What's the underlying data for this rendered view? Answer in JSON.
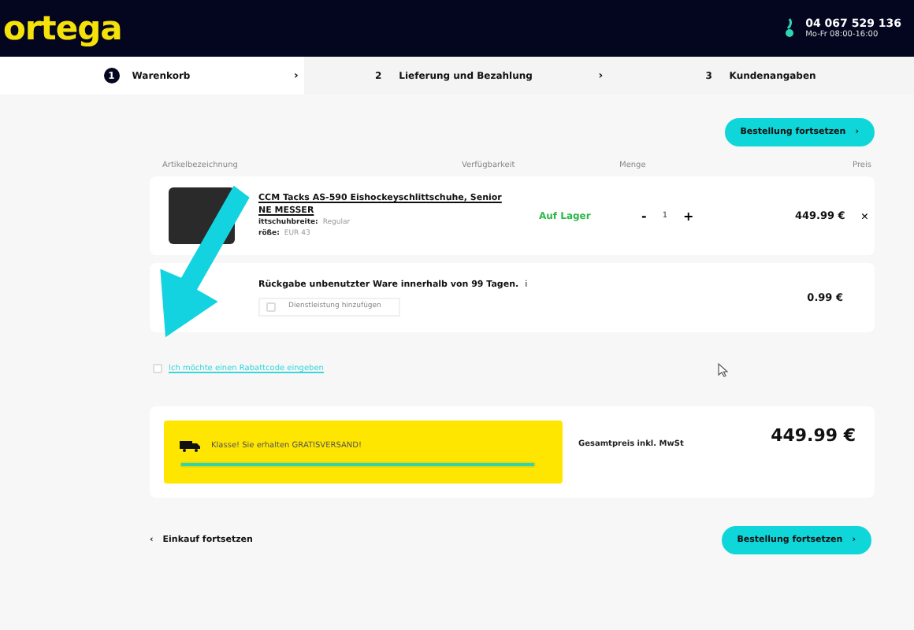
{
  "header": {
    "logo": "ortega",
    "phone": "04 067 529 136",
    "hours": "Mo-Fr 08:00-16:00"
  },
  "steps": [
    {
      "number": "1",
      "label": "Warenkorb",
      "selected": true,
      "chevron": "›"
    },
    {
      "number": "2",
      "label": "Lieferung und Bezahlung",
      "selected": false,
      "chevron": "›"
    },
    {
      "number": "3",
      "label": "Kundenangaben",
      "selected": false
    }
  ],
  "top_button": "Bestellung fortsetzen",
  "top_button_chevron": "›",
  "columns": [
    "Artikelbezeichnung",
    "Verfügbarkeit",
    "Menge",
    "Preis"
  ],
  "item": {
    "title_line1": "CCM Tacks AS-590 Eishockeyschlittschuhe, Senior",
    "title_line2": "NE MESSER",
    "attributes": [
      {
        "name": "ittschuhbreite:",
        "value": "Regular"
      },
      {
        "name": "röße:",
        "value": "EUR 43"
      }
    ],
    "availability": "Auf Lager",
    "minus": "-",
    "quantity": "1",
    "plus": "+",
    "price": "449.99 €",
    "remove": "×"
  },
  "service": {
    "title": "Rückgabe unbenutzter Ware innerhalb von 99 Tagen.",
    "info": "i",
    "option": "Dienstleistung hinzufügen",
    "checked": false,
    "price": "0.99 €"
  },
  "coupon": {
    "label": "Ich möchte einen Rabattcode eingeben",
    "checked": false
  },
  "shipping": {
    "message": "Klasse! Sie erhalten GRATISVERSAND!",
    "level": 1
  },
  "total": {
    "label": "Gesamtpreis inkl. MwSt",
    "value": "449.99 €"
  },
  "back_chevron": "‹",
  "back_link": "Einkauf fortsetzen",
  "bottom_button": "Bestellung fortsetzen",
  "bottom_button_chevron": "›"
}
